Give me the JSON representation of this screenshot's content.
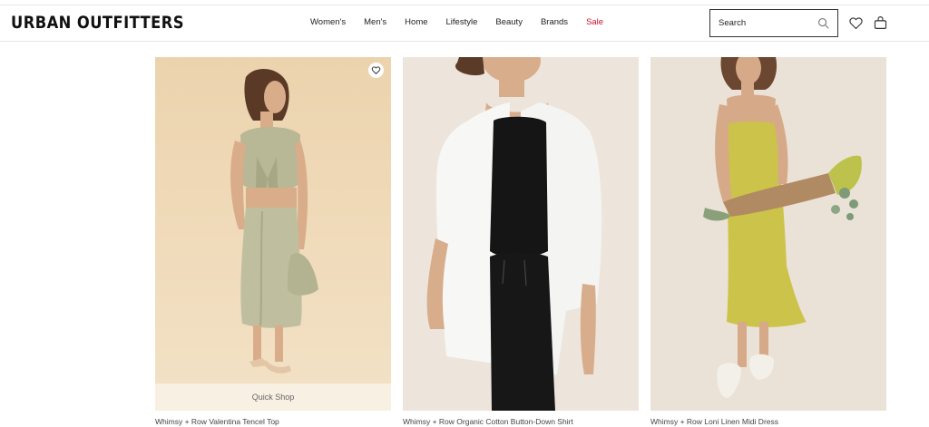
{
  "brand": {
    "logo": "URBAN OUTFITTERS"
  },
  "nav": {
    "items": [
      {
        "label": "Women's"
      },
      {
        "label": "Men's"
      },
      {
        "label": "Home"
      },
      {
        "label": "Lifestyle"
      },
      {
        "label": "Beauty"
      },
      {
        "label": "Brands"
      },
      {
        "label": "Sale"
      }
    ]
  },
  "search": {
    "placeholder": "Search"
  },
  "icons": {
    "search": "search-icon",
    "wishlist": "heart-icon",
    "cart": "shopping-bag-icon"
  },
  "colors": {
    "sale": "#c8102e"
  },
  "products": [
    {
      "title": "Whimsy + Row Valentina Tencel Top",
      "quick_shop": "Quick Shop"
    },
    {
      "title": "Whimsy + Row Organic Cotton Button-Down Shirt"
    },
    {
      "title": "Whimsy + Row Loni Linen Midi Dress"
    }
  ]
}
